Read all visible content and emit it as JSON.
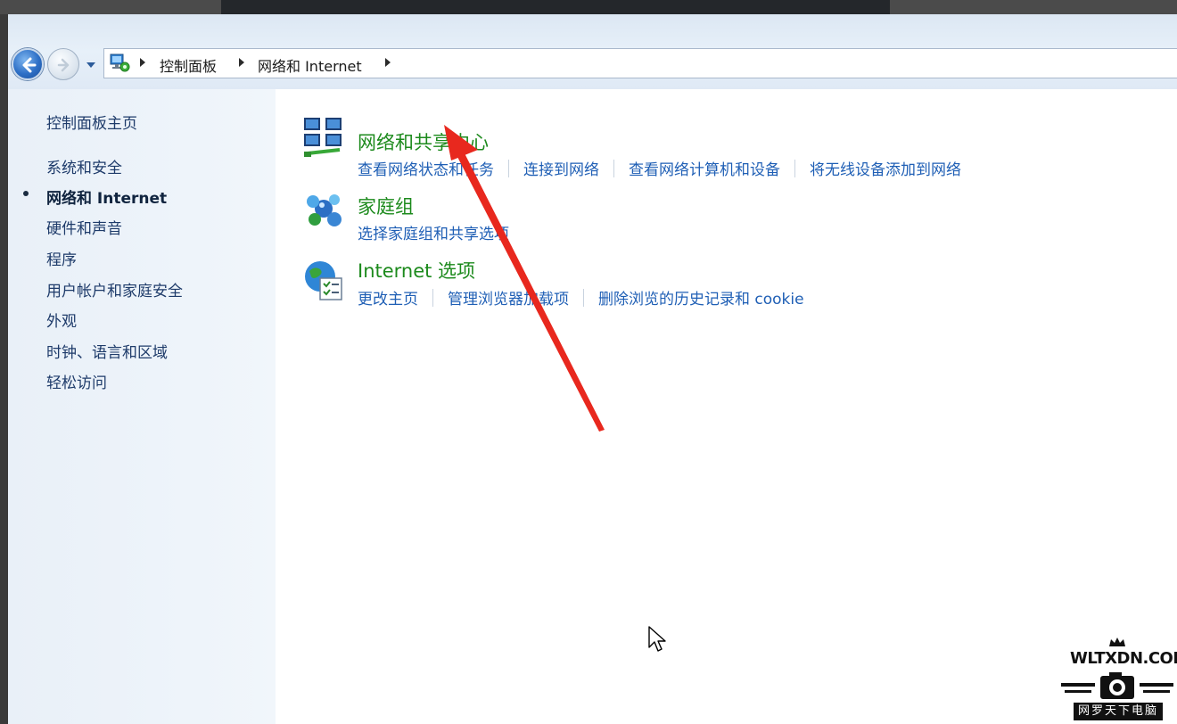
{
  "breadcrumbs": [
    "控制面板",
    "网络和 Internet"
  ],
  "sidebar": {
    "home": "控制面板主页",
    "items": [
      {
        "label": "系统和安全",
        "current": false
      },
      {
        "label": "网络和 Internet",
        "current": true
      },
      {
        "label": "硬件和声音",
        "current": false
      },
      {
        "label": "程序",
        "current": false
      },
      {
        "label": "用户帐户和家庭安全",
        "current": false
      },
      {
        "label": "外观",
        "current": false
      },
      {
        "label": "时钟、语言和区域",
        "current": false
      },
      {
        "label": "轻松访问",
        "current": false
      }
    ]
  },
  "categories": [
    {
      "title": "网络和共享中心",
      "icon": "network-sharing-center-icon",
      "links": [
        "查看网络状态和任务",
        "连接到网络",
        "查看网络计算机和设备",
        "将无线设备添加到网络"
      ]
    },
    {
      "title": "家庭组",
      "icon": "homegroup-icon",
      "links": [
        "选择家庭组和共享选项"
      ]
    },
    {
      "title": "Internet 选项",
      "icon": "internet-options-icon",
      "links": [
        "更改主页",
        "管理浏览器加载项",
        "删除浏览的历史记录和 cookie"
      ]
    }
  ],
  "colors": {
    "category_title": "#1c8a1c",
    "link": "#1f5fb5",
    "sidebar_bg": "#eef4fa",
    "annotation_arrow": "#e8281e"
  },
  "watermark": {
    "title": "WLTXDN.COM",
    "subtitle": "网罗天下电脑"
  }
}
